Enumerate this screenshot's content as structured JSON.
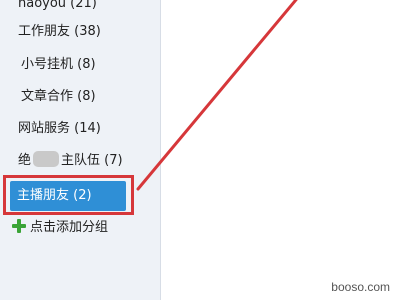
{
  "groups": [
    {
      "label": "haoyou (21)"
    },
    {
      "label": "工作朋友 (38)"
    },
    {
      "label": "小号挂机 (8)"
    },
    {
      "label": "文章合作 (8)"
    },
    {
      "label": "网站服务 (14)"
    },
    {
      "label_prefix": "绝",
      "label_suffix": "主队伍 (7)"
    },
    {
      "label": "主播朋友 (2)",
      "selected": true
    }
  ],
  "add_group_label": "点击添加分组",
  "watermark": "booso.com",
  "colors": {
    "selected_bg": "#2f8fd6",
    "annotation_red": "#d6373a",
    "add_icon_green": "#3aa437"
  }
}
